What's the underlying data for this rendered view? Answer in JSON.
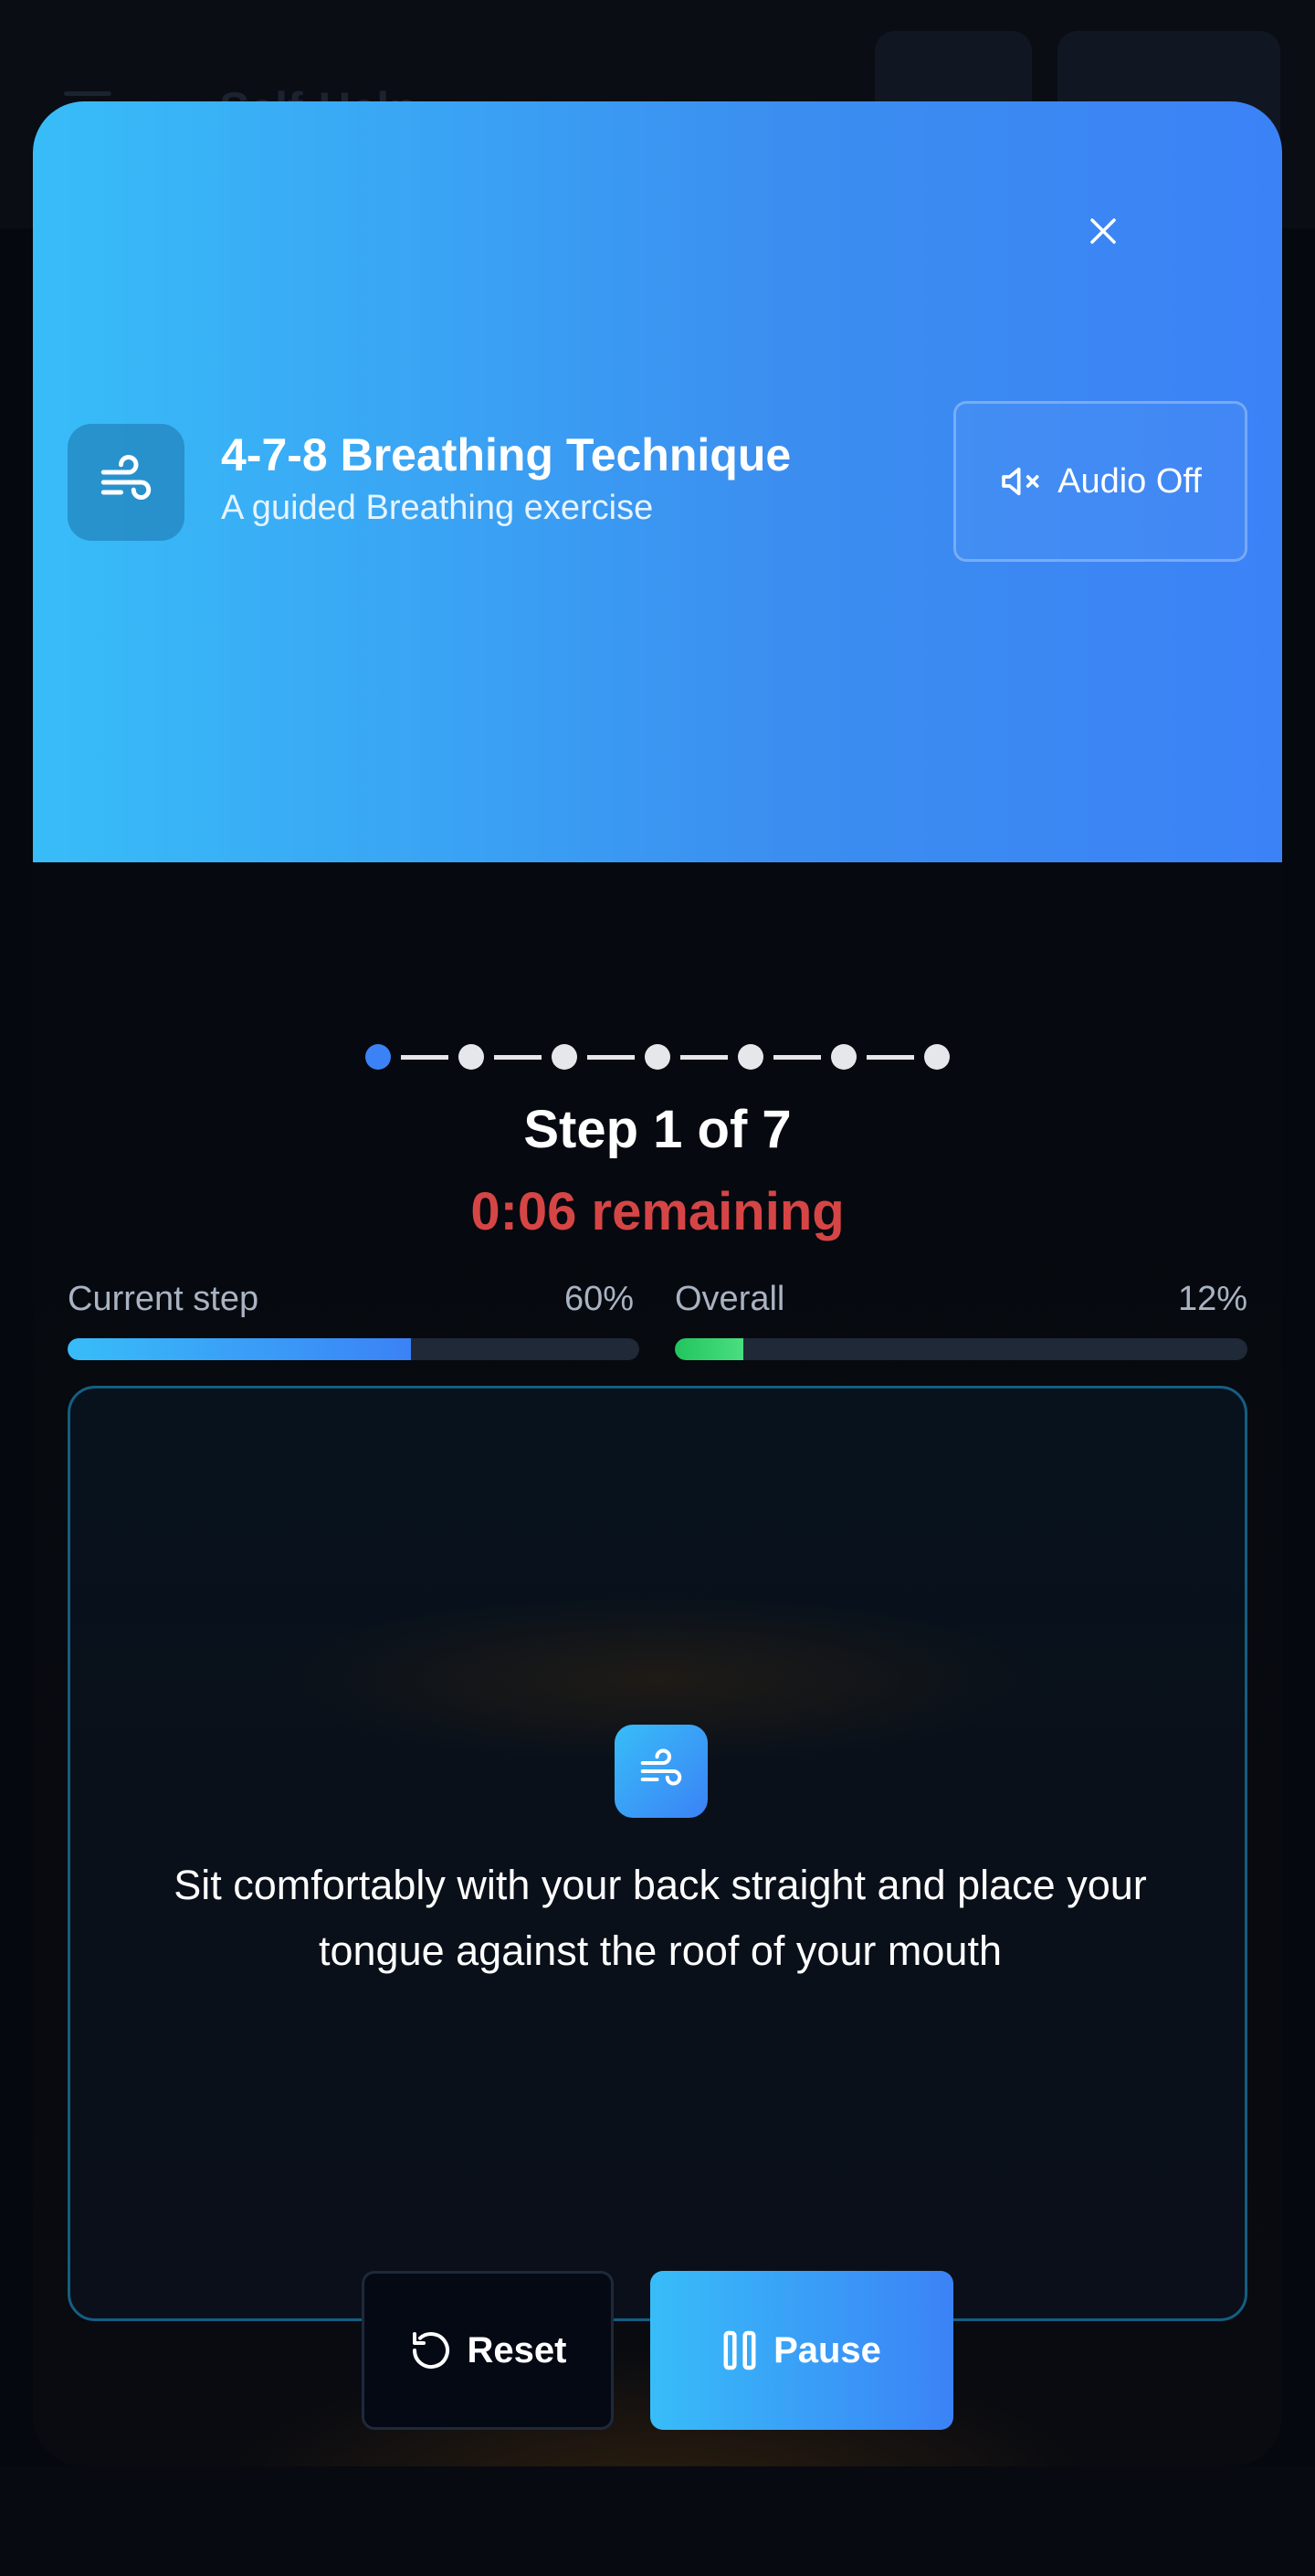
{
  "background_app": {
    "title": "Self-Help"
  },
  "modal": {
    "close_icon": "close-icon",
    "technique": {
      "icon": "wind-icon",
      "title": "4-7-8 Breathing Technique",
      "subtitle": "A guided Breathing exercise"
    },
    "audio": {
      "icon": "speaker-muted-icon",
      "label": "Audio Off"
    },
    "steps": {
      "total": 7,
      "current": 1,
      "title": "Step 1 of 7",
      "remaining": "0:06 remaining"
    },
    "progress": {
      "current_step": {
        "label": "Current step",
        "value_text": "60%",
        "fraction": 0.6
      },
      "overall": {
        "label": "Overall",
        "value_text": "12%",
        "fraction": 0.12
      }
    },
    "instruction": {
      "icon": "wind-icon",
      "text": "Sit comfortably with your back straight and place your tongue against the roof of your mouth"
    },
    "controls": {
      "reset": {
        "icon": "reset-icon",
        "label": "Reset"
      },
      "pause": {
        "icon": "pause-icon",
        "label": "Pause"
      }
    },
    "colors": {
      "header_start": "#38bdf8",
      "header_end": "#3b82f6",
      "remaining": "#d64545",
      "overall_fill": "#22c55e"
    }
  }
}
